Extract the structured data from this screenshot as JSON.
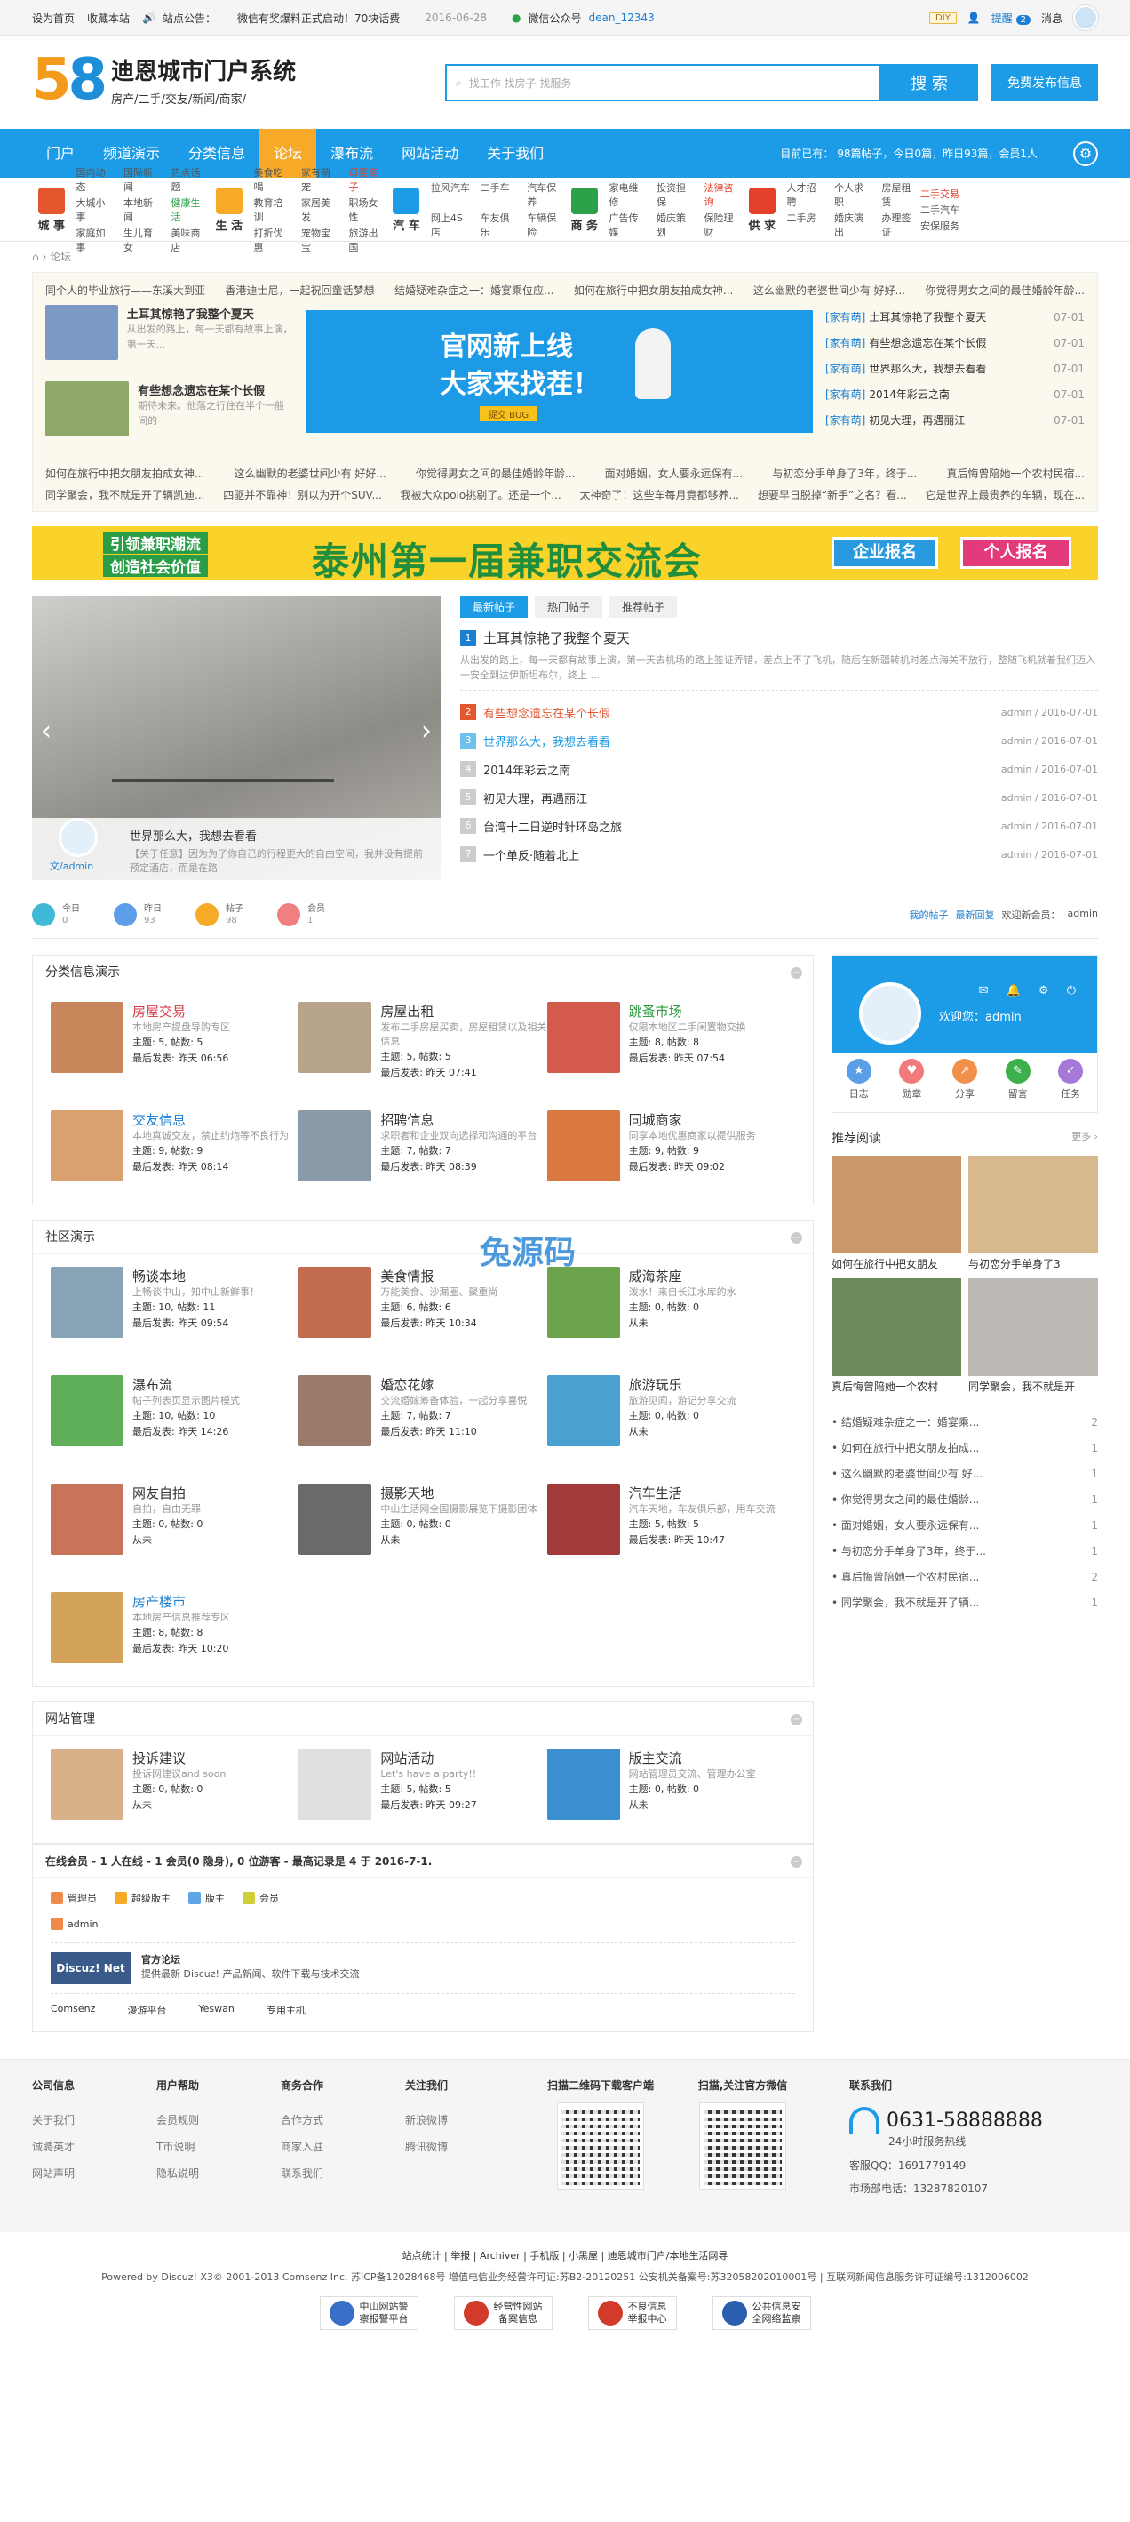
{
  "topbar": {
    "set_home": "设为首页",
    "bookmark": "收藏本站",
    "notice_label": "站点公告：",
    "notice_text": "微信有奖爆料正式启动！70块话费",
    "notice_date": "2016-06-28",
    "wechat_label": "微信公众号",
    "wechat_id": "dean_12343",
    "diy": "DIY",
    "remind": "提醒",
    "remind_count": "2",
    "message": "消息"
  },
  "header": {
    "logo_num_5": "5",
    "logo_num_8": "8",
    "site_name": "迪恩城市门户系统",
    "site_sub": "房产/二手/交友/新闻/商家/",
    "search_placeholder": "找工作 找房子 找服务",
    "search_btn": "搜 索",
    "post_btn": "免费发布信息"
  },
  "nav": {
    "items": [
      "门户",
      "频道演示",
      "分类信息",
      "论坛",
      "瀑布流",
      "网站活动",
      "关于我们"
    ],
    "active_index": 3,
    "stats": "目前已有： 98篇帖子，今日0篇，昨日93篇，会员1人"
  },
  "cats": [
    {
      "title": "城 事",
      "color": "#e4572e",
      "links": [
        "国内动态",
        "国际新闻",
        "热点话题",
        "大城小事",
        "本地新闻",
        "健康生活",
        "家庭如事",
        "生儿育女",
        "美味商店"
      ],
      "hl": [],
      "gr": [
        5
      ]
    },
    {
      "title": "生 活",
      "color": "#f7a928",
      "links": [
        "美食吃喝",
        "家有萌宠",
        "母婴亲子",
        "教育培训",
        "家居美发",
        "职场女性",
        "打折优惠",
        "宠物宝宝",
        "旅游出国"
      ],
      "hl": [
        2
      ],
      "gr": []
    },
    {
      "title": "汽 车",
      "color": "#1c9be6",
      "links": [
        "拉风汽车",
        "二手车",
        "汽车保养",
        "网上4S店",
        "车友俱乐",
        "车辆保险"
      ],
      "hl": [],
      "gr": []
    },
    {
      "title": "商 务",
      "color": "#2da14a",
      "links": [
        "家电维修",
        "投资担保",
        "法律咨询",
        "广告传媒",
        "婚庆策划",
        "保险理财"
      ],
      "hl": [
        2
      ],
      "gr": []
    },
    {
      "title": "供 求",
      "color": "#e4402a",
      "links": [
        "人才招聘",
        "个人求职",
        "房屋租赁",
        "二手房",
        "婚庆演出",
        "办理签证"
      ],
      "hl": [],
      "gr": []
    },
    {
      "title": "",
      "color": "#fff",
      "links": [
        "二手交易",
        "二手汽车",
        "安保服务"
      ],
      "hl": [
        0
      ],
      "gr": []
    }
  ],
  "breadcrumb": "论坛",
  "newsbox": {
    "row1": [
      "同个人的毕业旅行——东溪大到亚",
      "香港迪士尼，一起祝回童话梦想",
      "结婚疑难杂症之一：婚宴乘位应...",
      "如何在旅行中把女朋友拍成女神...",
      "这么幽默的老婆世间少有 好好...",
      "你觉得男女之间的最佳婚龄年龄..."
    ],
    "thumbs": [
      {
        "title": "土耳其惊艳了我整个夏天",
        "desc": "从出发的路上，每一天都有故事上演，第一天..."
      },
      {
        "title": "有些想念遗忘在某个长假",
        "desc": "期待未来。他落之行住在半个一般间的"
      }
    ],
    "banner_t1": "官网新上线",
    "banner_t2": "大家来找茬！",
    "banner_t3": "提交 BUG",
    "right": [
      {
        "tag": "[家有萌]",
        "title": "土耳其惊艳了我整个夏天",
        "date": "07-01"
      },
      {
        "tag": "[家有萌]",
        "title": "有些想念遗忘在某个长假",
        "date": "07-01"
      },
      {
        "tag": "[家有萌]",
        "title": "世界那么大，我想去看看",
        "date": "07-01"
      },
      {
        "tag": "[家有萌]",
        "title": "2014年彩云之南",
        "date": "07-01"
      },
      {
        "tag": "[家有萌]",
        "title": "初见大理，再遇丽江",
        "date": "07-01"
      }
    ],
    "row3": [
      "如何在旅行中把女朋友拍成女神...",
      "这么幽默的老婆世间少有 好好...",
      "你觉得男女之间的最佳婚龄年龄...",
      "面对婚姻，女人要永远保有...",
      "与初恋分手单身了3年，终于...",
      "真后悔曾陪她一个农村民宿..."
    ],
    "row4": [
      "同学聚会，我不就是开了辆凯迪...",
      "四驱并不靠神！别以为开个SUV...",
      "我被大众polo挑剔了。还是一个...",
      "太神奇了！这些车每月竟都够养...",
      "想要早日脱掉“新手”之名？看...",
      "它是世界上最贵养的车辆，现在..."
    ]
  },
  "ad": {
    "line1": "引领兼职潮流",
    "line2": "创造社会价值",
    "big": "泰州第一届兼职交流会",
    "btn1": "企业报名",
    "btn2": "个人报名"
  },
  "slider": {
    "title": "世界那么大，我想去看看",
    "desc": "【关于任意】因为为了你自己的行程更大的自由空间，我并没有提前预定酒店，而是在路",
    "author": "文/admin"
  },
  "hot": {
    "tabs": [
      "最新帖子",
      "热门帖子",
      "推荐帖子"
    ],
    "top_title": "土耳其惊艳了我整个夏天",
    "top_desc": "从出发的路上，每一天都有故事上演，第一天去机场的路上签证弄错，差点上不了飞机，随后在新疆转机时差点海关不放行，整随飞机就着我们迈入一安全到达伊斯坦布尔，终上 ...",
    "rows": [
      {
        "n": "2",
        "title": "有些想念遗忘在某个长假",
        "meta": "admin / 2016-07-01"
      },
      {
        "n": "3",
        "title": "世界那么大，我想去看看",
        "meta": "admin / 2016-07-01"
      },
      {
        "n": "4",
        "title": "2014年彩云之南",
        "meta": "admin / 2016-07-01"
      },
      {
        "n": "5",
        "title": "初见大理，再遇丽江",
        "meta": "admin / 2016-07-01"
      },
      {
        "n": "6",
        "title": "台湾十二日逆时针环岛之旅",
        "meta": "admin / 2016-07-01"
      },
      {
        "n": "7",
        "title": "一个单反·随着北上",
        "meta": "admin / 2016-07-01"
      }
    ],
    "top_meta": ""
  },
  "stats": [
    {
      "label": "今日",
      "value": "0",
      "color": "#3fb9d6"
    },
    {
      "label": "昨日",
      "value": "93",
      "color": "#5e9ee8"
    },
    {
      "label": "帖子",
      "value": "98",
      "color": "#f7a928"
    },
    {
      "label": "会员",
      "value": "1",
      "color": "#f08080"
    }
  ],
  "statlinks": {
    "my": "我的帖子",
    "new": "最新回复",
    "welcome": "欢迎新会员：",
    "member": "admin"
  },
  "sections": [
    {
      "title": "分类信息演示",
      "forums": [
        {
          "name": "房屋交易",
          "cls": "c1",
          "desc": "本地房产提盘导购专区",
          "stat": "主题: 5, 帖数: 5",
          "last": "最后发表: 昨天 06:56",
          "img": "#c9865b"
        },
        {
          "name": "房屋出租",
          "cls": "",
          "desc": "发布二手房屋买卖，房屋租赁以及相关信息",
          "stat": "主题: 5, 帖数: 5",
          "last": "最后发表: 昨天 07:41",
          "img": "#b7a48a"
        },
        {
          "name": "跳蚤市场",
          "cls": "c3",
          "desc": "仅限本地区二手闲置物交换",
          "stat": "主题: 8, 帖数: 8",
          "last": "最后发表: 昨天 07:54",
          "img": "#d45b4b"
        },
        {
          "name": "交友信息",
          "cls": "c2",
          "desc": "本地真诚交友，禁止约炮等不良行为",
          "stat": "主题: 9, 帖数: 9",
          "last": "最后发表: 昨天 08:14",
          "img": "#d9a070"
        },
        {
          "name": "招聘信息",
          "cls": "",
          "desc": "求职者和企业双向选择和沟通的平台",
          "stat": "主题: 7, 帖数: 7",
          "last": "最后发表: 昨天 08:39",
          "img": "#8a9aa8"
        },
        {
          "name": "同城商家",
          "cls": "",
          "desc": "同享本地优惠商家以提供服务",
          "stat": "主题: 9, 帖数: 9",
          "last": "最后发表: 昨天 09:02",
          "img": "#d97840"
        }
      ]
    },
    {
      "title": "社区演示",
      "forums": [
        {
          "name": "畅谈本地",
          "cls": "",
          "desc": "上畅谈中山，知中山新鲜事！",
          "stat": "主题: 10, 帖数: 11",
          "last": "最后发表: 昨天 09:54",
          "img": "#8aa4b7"
        },
        {
          "name": "美食情报",
          "cls": "",
          "desc": "万能美食、沙漏圈、聚重尚",
          "stat": "主题: 6, 帖数: 6",
          "last": "最后发表: 昨天 10:34",
          "img": "#c26b4e"
        },
        {
          "name": "威海茶座",
          "cls": "",
          "desc": "泼水！来自长江水库的水",
          "stat": "主题: 0, 帖数: 0",
          "last": "从未",
          "img": "#6da34d"
        },
        {
          "name": "瀑布流",
          "cls": "",
          "desc": "帖子列表页显示图片模式",
          "stat": "主题: 10, 帖数: 10",
          "last": "最后发表: 昨天 14:26",
          "img": "#5fae5a"
        },
        {
          "name": "婚恋花嫁",
          "cls": "",
          "desc": "交流婚嫁筹备体验，一起分享喜悦",
          "stat": "主题: 7, 帖数: 7",
          "last": "最后发表: 昨天 11:10",
          "img": "#9a7a6a"
        },
        {
          "name": "旅游玩乐",
          "cls": "",
          "desc": "旅游见闻，游记分享交流",
          "stat": "主题: 0, 帖数: 0",
          "last": "从未",
          "img": "#4aa0d0"
        },
        {
          "name": "网友自拍",
          "cls": "",
          "desc": "自拍，自由无罪",
          "stat": "主题: 0, 帖数: 0",
          "last": "从未",
          "img": "#c8745a"
        },
        {
          "name": "摄影天地",
          "cls": "",
          "desc": "中山生活网全国摄影展览下摄影团体",
          "stat": "主题: 0, 帖数: 0",
          "last": "从未",
          "img": "#6a6a6a"
        },
        {
          "name": "汽车生活",
          "cls": "",
          "desc": "汽车天地，车友俱乐部，用车交流",
          "stat": "主题: 5, 帖数: 5",
          "last": "最后发表: 昨天 10:47",
          "img": "#a33a3a"
        },
        {
          "name": "房产楼市",
          "cls": "c2",
          "desc": "本地房产信息推荐专区",
          "stat": "主题: 8, 帖数: 8",
          "last": "最后发表: 昨天 10:20",
          "img": "#d4a35a"
        }
      ]
    },
    {
      "title": "网站管理",
      "forums": [
        {
          "name": "投诉建议",
          "cls": "",
          "desc": "投诉网建议and soon",
          "stat": "主题: 0, 帖数: 0",
          "last": "从未",
          "img": "#d8b08a"
        },
        {
          "name": "网站活动",
          "cls": "",
          "desc": "Let's have a party!!",
          "stat": "主题: 5, 帖数: 5",
          "last": "最后发表: 昨天 09:27",
          "img": "#e0e0e0"
        },
        {
          "name": "版主交流",
          "cls": "",
          "desc": "网站管理员交流、管理办公室",
          "stat": "主题: 0, 帖数: 0",
          "last": "从未",
          "img": "#3a8fd0"
        }
      ]
    }
  ],
  "online": {
    "title": "在线会员 - 1 人在线 - 1 会员(0 隐身), 0 位游客 - 最高记录是 4 于 2016-7-1.",
    "legend": [
      {
        "label": "管理员",
        "color": "#f08a4b"
      },
      {
        "label": "超级版主",
        "color": "#f7a928"
      },
      {
        "label": "版主",
        "color": "#5ea6e6"
      },
      {
        "label": "会员",
        "color": "#cfcf3a"
      }
    ],
    "member": "admin",
    "friend_logo": "Discuz! Net",
    "friend_title": "官方论坛",
    "friend_desc": "提供最新 Discuz! 产品新闻、软件下载与技术交流",
    "flinks": [
      "Comsenz",
      "漫游平台",
      "Yeswan",
      "专用主机"
    ]
  },
  "usercard": {
    "welcome": "欢迎您：admin",
    "icons": "✉ 🔔 ⚙ ⏻",
    "acts": [
      {
        "label": "日志",
        "color": "#5b9ee8",
        "g": "★"
      },
      {
        "label": "勋章",
        "color": "#f27a7a",
        "g": "♥"
      },
      {
        "label": "分享",
        "color": "#f0904a",
        "g": "↗"
      },
      {
        "label": "留言",
        "color": "#3cb04a",
        "g": "✎"
      },
      {
        "label": "任务",
        "color": "#a678d8",
        "g": "✓"
      }
    ]
  },
  "recommend": {
    "title": "推荐阅读",
    "more": "更多 ›",
    "items": [
      {
        "title": "如何在旅行中把女朋友",
        "color": "#c9976a"
      },
      {
        "title": "与初恋分手单身了3",
        "color": "#d8b88f"
      },
      {
        "title": "真后悔曾陪她一个农村",
        "color": "#6a8a5a"
      },
      {
        "title": "同学聚会，我不就是开",
        "color": "#bcb8b3"
      }
    ],
    "list": [
      {
        "t": "结婚疑难杂症之一：婚宴乘...",
        "n": "2"
      },
      {
        "t": "如何在旅行中把女朋友拍成...",
        "n": "1"
      },
      {
        "t": "这么幽默的老婆世间少有 好...",
        "n": "1"
      },
      {
        "t": "你觉得男女之间的最佳婚龄...",
        "n": "1"
      },
      {
        "t": "面对婚姻，女人要永远保有...",
        "n": "1"
      },
      {
        "t": "与初恋分手单身了3年，终于...",
        "n": "1"
      },
      {
        "t": "真后悔曾陪她一个农村民宿...",
        "n": "2"
      },
      {
        "t": "同学聚会，我不就是开了辆...",
        "n": "1"
      }
    ]
  },
  "watermark": "兔源码",
  "footer": {
    "cols": [
      {
        "h": "公司信息",
        "l": [
          "关于我们",
          "诚聘英才",
          "网站声明"
        ]
      },
      {
        "h": "用户帮助",
        "l": [
          "会员规则",
          "T币说明",
          "隐私说明"
        ]
      },
      {
        "h": "商务合作",
        "l": [
          "合作方式",
          "商家入驻",
          "联系我们"
        ]
      },
      {
        "h": "关注我们",
        "l": [
          "新浪微博",
          "腾讯微博"
        ]
      }
    ],
    "qr1": "扫描二维码下载客户端",
    "qr2": "扫描,关注官方微信",
    "contact_h": "联系我们",
    "tel": "0631-58888888",
    "tel_sub": "24小时服务热线",
    "qq": "客服QQ：1691779149",
    "market": "市场部电话：13287820107",
    "bottom1": "站点统计 | 举报 | Archiver | 手机版 | 小黑屋 | 迪恩城市门户/本地生活网导",
    "bottom2": "Powered by Discuz! X3© 2001-2013 Comsenz Inc. 苏ICP备12028468号 增值电信业务经营许可证:苏B2-20120251 公安机关备案号:苏32058202010001号 | 互联网新闻信息服务许可证编号:1312006002",
    "seals": [
      {
        "t1": "中山网站警",
        "t2": "察报警平台",
        "c": "#3a6fc8"
      },
      {
        "t1": "经营性网站",
        "t2": "备案信息",
        "c": "#d23a2a"
      },
      {
        "t1": "不良信息",
        "t2": "举报中心",
        "c": "#d23a2a"
      },
      {
        "t1": "公共信息安",
        "t2": "全网络监察",
        "c": "#2a5fb0"
      }
    ]
  }
}
